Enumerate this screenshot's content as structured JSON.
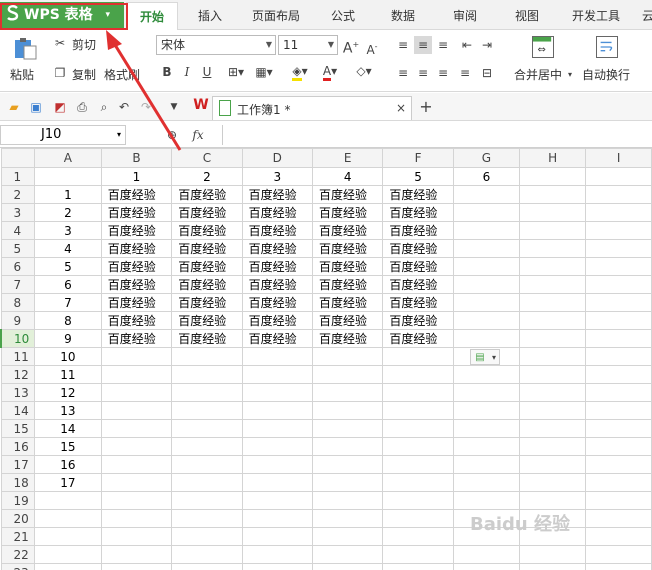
{
  "app": {
    "brand": "WPS 表格",
    "menu_arrow": "▾"
  },
  "tabs": [
    {
      "label": "开始",
      "active": true
    },
    {
      "label": "插入"
    },
    {
      "label": "页面布局"
    },
    {
      "label": "公式"
    },
    {
      "label": "数据"
    },
    {
      "label": "审阅"
    },
    {
      "label": "视图"
    },
    {
      "label": "开发工具"
    },
    {
      "label": "云"
    }
  ],
  "ribbon": {
    "paste": "粘贴",
    "cut": "剪切",
    "copy": "复制",
    "format_painter": "格式刷",
    "font_name": "宋体",
    "font_size": "11",
    "merge_center": "合并居中",
    "wrap_text": "自动换行"
  },
  "document": {
    "tab_title": "工作簿1 *"
  },
  "formula_bar": {
    "cell_ref": "J10",
    "fx": "fx"
  },
  "sheet": {
    "columns": [
      "A",
      "B",
      "C",
      "D",
      "E",
      "F",
      "G",
      "H",
      "I"
    ],
    "rows": [
      "1",
      "2",
      "3",
      "4",
      "5",
      "6",
      "7",
      "8",
      "9",
      "10",
      "11",
      "12",
      "13",
      "14",
      "15",
      "16",
      "17",
      "18",
      "19",
      "20",
      "21",
      "22",
      "23"
    ],
    "header_row_values": [
      "1",
      "2",
      "3",
      "4",
      "5",
      "6"
    ],
    "col_a_values": [
      "1",
      "2",
      "3",
      "4",
      "5",
      "6",
      "7",
      "8",
      "9",
      "10",
      "11",
      "12",
      "13",
      "14",
      "15",
      "16",
      "17"
    ],
    "cell_text": "百度经验",
    "selected_row": "10"
  },
  "watermark": "Baidu 经验"
}
